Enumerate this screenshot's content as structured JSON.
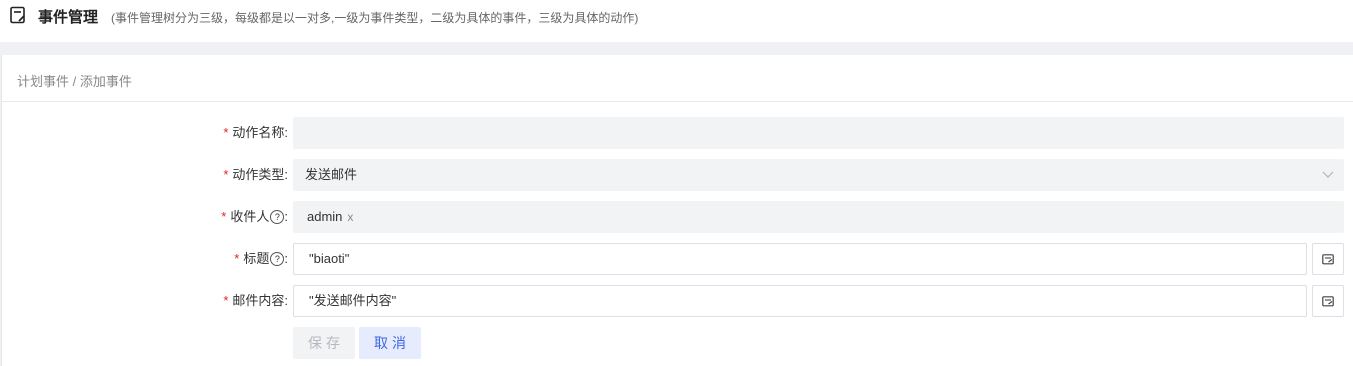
{
  "header": {
    "title": "事件管理",
    "subtitle": "(事件管理树分为三级，每级都是以一对多,一级为事件类型，二级为具体的事件，三级为具体的动作)",
    "icon": "document-edit-icon"
  },
  "breadcrumb": "计划事件 / 添加事件",
  "form": {
    "required_mark": "*",
    "help_glyph": "?",
    "action_name": {
      "label": "动作名称:",
      "value": ""
    },
    "action_type": {
      "label": "动作类型:",
      "value": "发送邮件"
    },
    "recipients": {
      "label": "收件人",
      "colon": ":",
      "tags": [
        "admin"
      ],
      "remove_glyph": "x"
    },
    "subject": {
      "label": "标题",
      "colon": ":",
      "value": "\"biaoti\""
    },
    "content": {
      "label": "邮件内容:",
      "value": "\"发送邮件内容\""
    }
  },
  "buttons": {
    "save": "保存",
    "cancel": "取消"
  },
  "colors": {
    "accent": "#3f66e6",
    "required": "#e02424",
    "field_bg": "#f2f3f5"
  }
}
